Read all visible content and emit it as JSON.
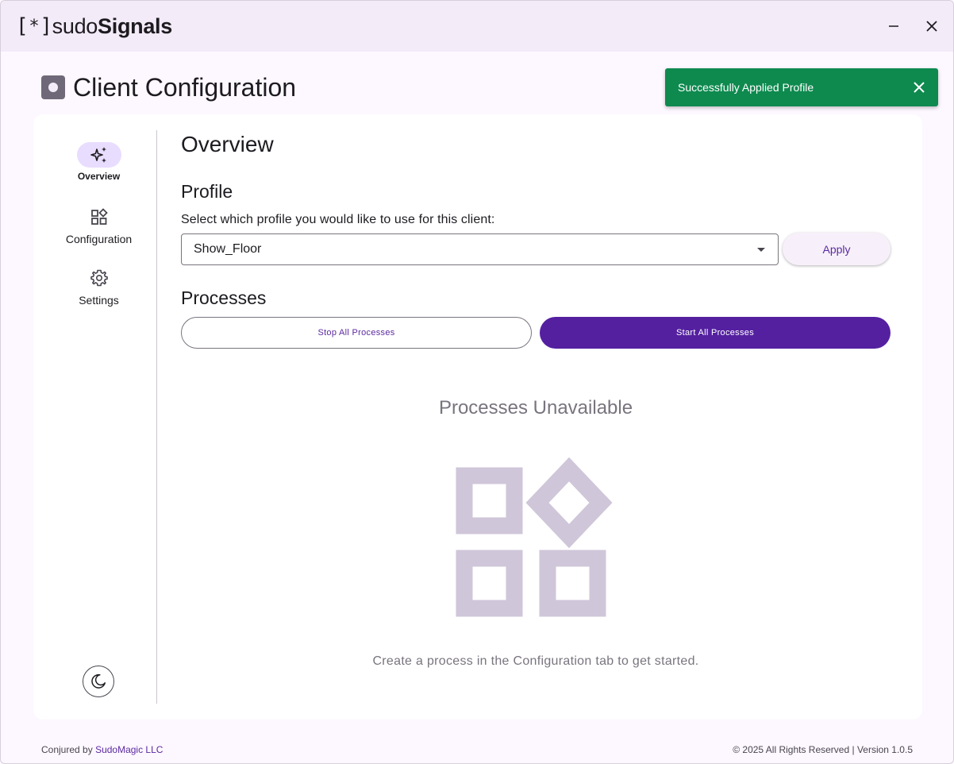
{
  "app": {
    "logo_bracket_open": "[",
    "logo_star": "*",
    "logo_bracket_close": "]",
    "logo_light": "sudo",
    "logo_bold": "Signals"
  },
  "window_controls": {
    "minimize_icon": "minus-icon",
    "close_icon": "close-icon"
  },
  "page": {
    "title": "Client Configuration",
    "title_icon": "record-icon"
  },
  "toast": {
    "message": "Successfully Applied Profile",
    "color": "#0e8a4f",
    "close_icon": "close-icon"
  },
  "sidebar": {
    "items": [
      {
        "label": "Overview",
        "icon": "sparkle-icon",
        "active": true
      },
      {
        "label": "Configuration",
        "icon": "widgets-icon",
        "active": false
      },
      {
        "label": "Settings",
        "icon": "gear-icon",
        "active": false
      }
    ],
    "theme_toggle_icon": "moon-icon"
  },
  "main": {
    "heading": "Overview",
    "profile": {
      "heading": "Profile",
      "help_text": "Select which profile you would like to use for this client:",
      "selected": "Show_Floor",
      "apply_label": "Apply"
    },
    "processes": {
      "heading": "Processes",
      "stop_label": "Stop All Processes",
      "start_label": "Start All Processes",
      "empty_title": "Processes Unavailable",
      "empty_text": "Create a process in the Configuration tab to get started."
    }
  },
  "footer": {
    "credit_prefix": "Conjured by",
    "credit_link": "SudoMagic LLC",
    "copyright": "© 2025 All Rights Reserved | Version 1.0.5"
  },
  "colors": {
    "accent": "#5420a0",
    "accent_light": "#e8ddff",
    "illustration": "#cfc6d9"
  }
}
